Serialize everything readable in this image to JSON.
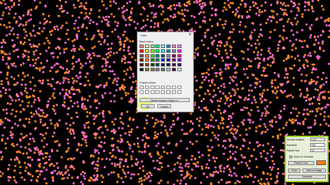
{
  "colors": {
    "background": "#000000",
    "dot_orange": "#ff8a2a",
    "dot_pink": "#ff6fcf",
    "panel_border": "#9ed11f"
  },
  "dialog": {
    "title": "Color",
    "close_icon": "close-icon",
    "basic_colors_label": "Basic colors:",
    "custom_colors_label": "Custom colors:",
    "define_button": "Define Custom Colors >>",
    "ok_button": "OK",
    "cancel_button": "Cancel",
    "basic_colors": [
      "#ff8080",
      "#ffff80",
      "#80ff80",
      "#00ff80",
      "#80ffff",
      "#0080ff",
      "#ff80c0",
      "#ff80ff",
      "#ff0000",
      "#ffff00",
      "#80ff00",
      "#00ff40",
      "#00ffff",
      "#0080c0",
      "#8080c0",
      "#ff00ff",
      "#804040",
      "#ff8040",
      "#00ff00",
      "#008080",
      "#004080",
      "#8080ff",
      "#800040",
      "#ff0080",
      "#800000",
      "#ff8000",
      "#008000",
      "#008040",
      "#0000ff",
      "#0000a0",
      "#800080",
      "#8000ff",
      "#400000",
      "#804000",
      "#004000",
      "#004040",
      "#000080",
      "#000040",
      "#400040",
      "#400080",
      "#000000",
      "#808000",
      "#808040",
      "#808080",
      "#408080",
      "#c0c0c0",
      "#400040",
      "#ffffff"
    ],
    "custom_colors_count": 16
  },
  "panel": {
    "density_label": "Density Multiplier",
    "density_value": "1.00",
    "subdivide_label": "Subdivide",
    "subdivide_value": "100",
    "particle_size_label": "Particle Size",
    "particle_size_value": "10",
    "clear_label": "Clear On Generate",
    "particle_color_button": "Particle Color",
    "particle_color": "#ff7a1a",
    "clear_button": "Clear",
    "save_button": "Save as Image",
    "generate_button": "Generate"
  }
}
